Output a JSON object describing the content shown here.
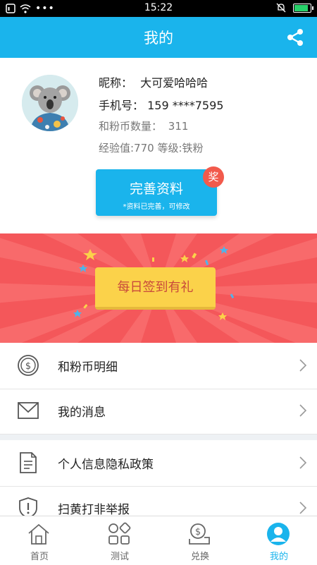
{
  "status": {
    "time": "15:22",
    "carrier_glyph": "⁝⁝",
    "battery_level": 0.8
  },
  "header": {
    "title": "我的"
  },
  "profile": {
    "nickname_label": "昵称：",
    "nickname": "大可爱哈哈哈",
    "phone_label": "手机号：",
    "phone": "159 ****7595",
    "coins_label": "和粉币数量：",
    "coins": "311",
    "exp_line": "经验值:770  等级:铁粉",
    "complete_button": "完善资料",
    "complete_sub": "*资料已完善，可修改",
    "award_badge": "奖"
  },
  "banner": {
    "signin_button": "每日签到有礼"
  },
  "menu": {
    "items": [
      {
        "label": "和粉币明细",
        "icon": "coin-icon"
      },
      {
        "label": "我的消息",
        "icon": "mail-icon"
      },
      {
        "label": "个人信息隐私政策",
        "icon": "document-icon"
      },
      {
        "label": "扫黄打非举报",
        "icon": "shield-icon"
      }
    ]
  },
  "tabs": [
    {
      "label": "首页",
      "icon": "home-icon"
    },
    {
      "label": "测试",
      "icon": "grid-icon"
    },
    {
      "label": "兑换",
      "icon": "exchange-icon"
    },
    {
      "label": "我的",
      "icon": "user-icon",
      "active": true
    }
  ],
  "colors": {
    "primary": "#1ab4ec",
    "banner": "#f4575a",
    "signin": "#fbd24a",
    "badge": "#f25a4c"
  }
}
